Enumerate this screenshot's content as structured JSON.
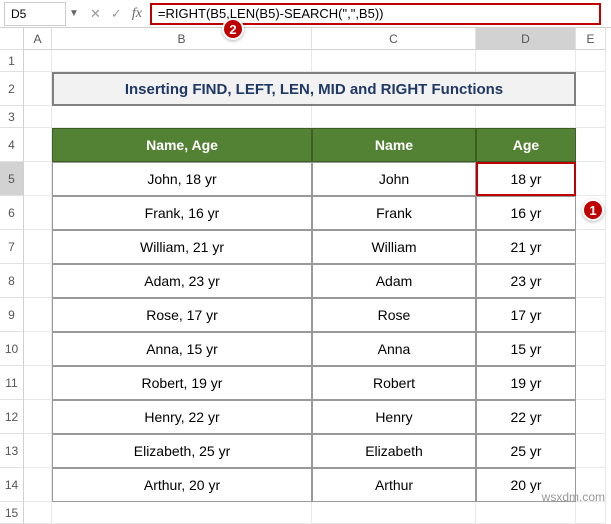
{
  "namebox": "D5",
  "formula": "=RIGHT(B5,LEN(B5)-SEARCH(\",\",B5))",
  "fx_label": "fx",
  "markers": {
    "one": "1",
    "two": "2"
  },
  "columns": [
    "A",
    "B",
    "C",
    "D",
    "E"
  ],
  "rows": [
    "1",
    "2",
    "3",
    "4",
    "5",
    "6",
    "7",
    "8",
    "9",
    "10",
    "11",
    "12",
    "13",
    "14",
    "15"
  ],
  "title": "Inserting FIND, LEFT, LEN, MID and RIGHT Functions",
  "headers": {
    "name_age": "Name, Age",
    "name": "Name",
    "age": "Age"
  },
  "data": [
    {
      "name_age": "John, 18 yr",
      "name": "John",
      "age": " 18 yr"
    },
    {
      "name_age": "Frank, 16 yr",
      "name": "Frank",
      "age": " 16 yr"
    },
    {
      "name_age": "William, 21 yr",
      "name": "William",
      "age": " 21 yr"
    },
    {
      "name_age": "Adam, 23 yr",
      "name": "Adam",
      "age": " 23 yr"
    },
    {
      "name_age": "Rose, 17 yr",
      "name": "Rose",
      "age": " 17 yr"
    },
    {
      "name_age": "Anna, 15 yr",
      "name": "Anna",
      "age": " 15 yr"
    },
    {
      "name_age": "Robert, 19 yr",
      "name": "Robert",
      "age": " 19 yr"
    },
    {
      "name_age": "Henry, 22 yr",
      "name": "Henry",
      "age": " 22 yr"
    },
    {
      "name_age": "Elizabeth, 25 yr",
      "name": "Elizabeth",
      "age": " 25 yr"
    },
    {
      "name_age": "Arthur, 20 yr",
      "name": "Arthur",
      "age": " 20 yr"
    }
  ],
  "watermark": "wsxdm.com"
}
